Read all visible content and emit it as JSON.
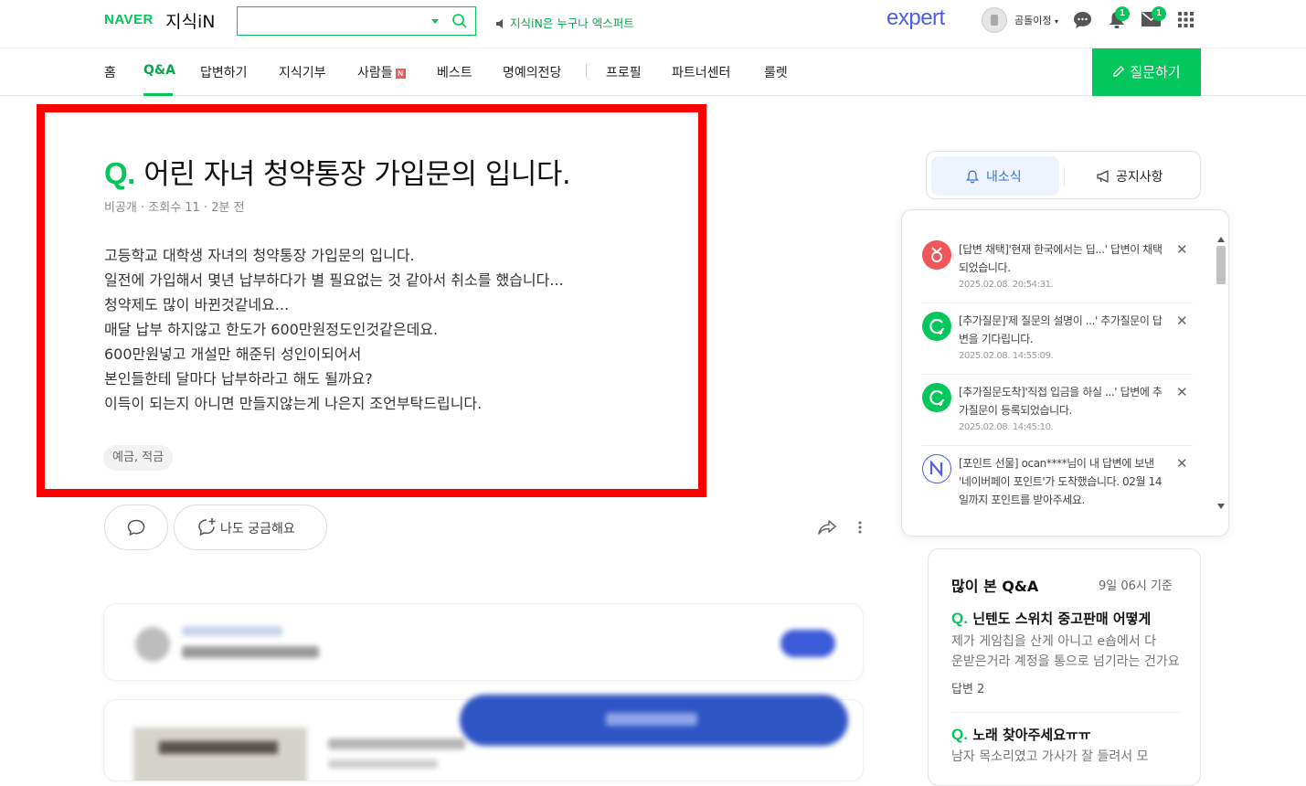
{
  "header": {
    "logo_naver": "NAVER",
    "logo_kin": "지식iN",
    "search": {
      "value": "",
      "placeholder": ""
    },
    "notice": "지식iN은 누구나 엑스퍼트",
    "expert_logo": "expert",
    "nickname": "곰돌이정",
    "chat_icon": "chat-bubble-icon",
    "notif_badge": "1",
    "mail_badge": "1"
  },
  "nav": {
    "items": [
      "홈",
      "Q&A",
      "답변하기",
      "지식기부",
      "사람들",
      "베스트",
      "명예의전당",
      "프로필",
      "파트너센터",
      "룰렛"
    ],
    "active": "Q&A",
    "new_badge": "N",
    "ask_button": "질문하기"
  },
  "question": {
    "mark": "Q.",
    "title": "어린 자녀 청약통장 가입문의 입니다.",
    "meta": "비공개 · 조회수 11 · 2분 전",
    "body": [
      "고등학교 대학생 자녀의 청약통장 가입문의 입니다.",
      "일전에 가입해서 몇년 납부하다가 별 필요없는 것 같아서 취소를 했습니다...",
      "청약제도 많이 바뀐것같네요...",
      "매달 납부 하지않고 한도가 600만원정도인것같은데요.",
      "600만원넣고 개설만 해준뒤 성인이되어서",
      "본인들한테 달마다 납부하라고 해도 될까요?",
      "이득이 되는지 아니면 만들지않는게 나은지 조언부탁드립니다."
    ],
    "tag": "예금, 적금",
    "curious_button": "나도 궁금해요"
  },
  "sidebar": {
    "tabs": [
      "내소식",
      "공지사항"
    ],
    "notifications": [
      {
        "text": "[답변 채택]'현재 한국에서는 딥...' 답변이 채택되었습니다.",
        "date": "2025.02.08. 20:54:31.",
        "icon": "trophy-icon",
        "color": "#f2555a"
      },
      {
        "text": "[추가질문]'제 질문의 설명이 ...' 추가질문이 답변을 기다립니다.",
        "date": "2025.02.08. 14:55:09.",
        "icon": "refresh-plus-icon",
        "color": "#03c75a"
      },
      {
        "text": "[추가질문도착]'직접 입금을 하실 ...' 답변에 추가질문이 등록되었습니다.",
        "date": "2025.02.08. 14:45:10.",
        "icon": "refresh-plus-icon",
        "color": "#03c75a"
      },
      {
        "text": "[포인트 선물] ocan****님이 내 답변에 보낸 '네이버페이 포인트'가 도착했습니다. 02월 14일까지 포인트를 받아주세요.",
        "date": "",
        "icon": "npay-icon",
        "color": "#4e5fe6"
      }
    ],
    "popular": {
      "title": "많이 본 Q&A",
      "time": "9일 06시 기준",
      "items": [
        {
          "q": "닌텐도 스위치 중고판매 어떻게",
          "a_lines": [
            "제가 게임칩을 산게 아니고 e숍에서 다",
            "운받은거라 계정을 통으로 넘기라는 건가요"
          ],
          "count": "답변 2"
        },
        {
          "q": "노래 찾아주세요ㅠㅠ",
          "a_lines": [
            "남자 목소리였고 가사가 잘 들려서 모"
          ],
          "count": ""
        }
      ]
    }
  }
}
